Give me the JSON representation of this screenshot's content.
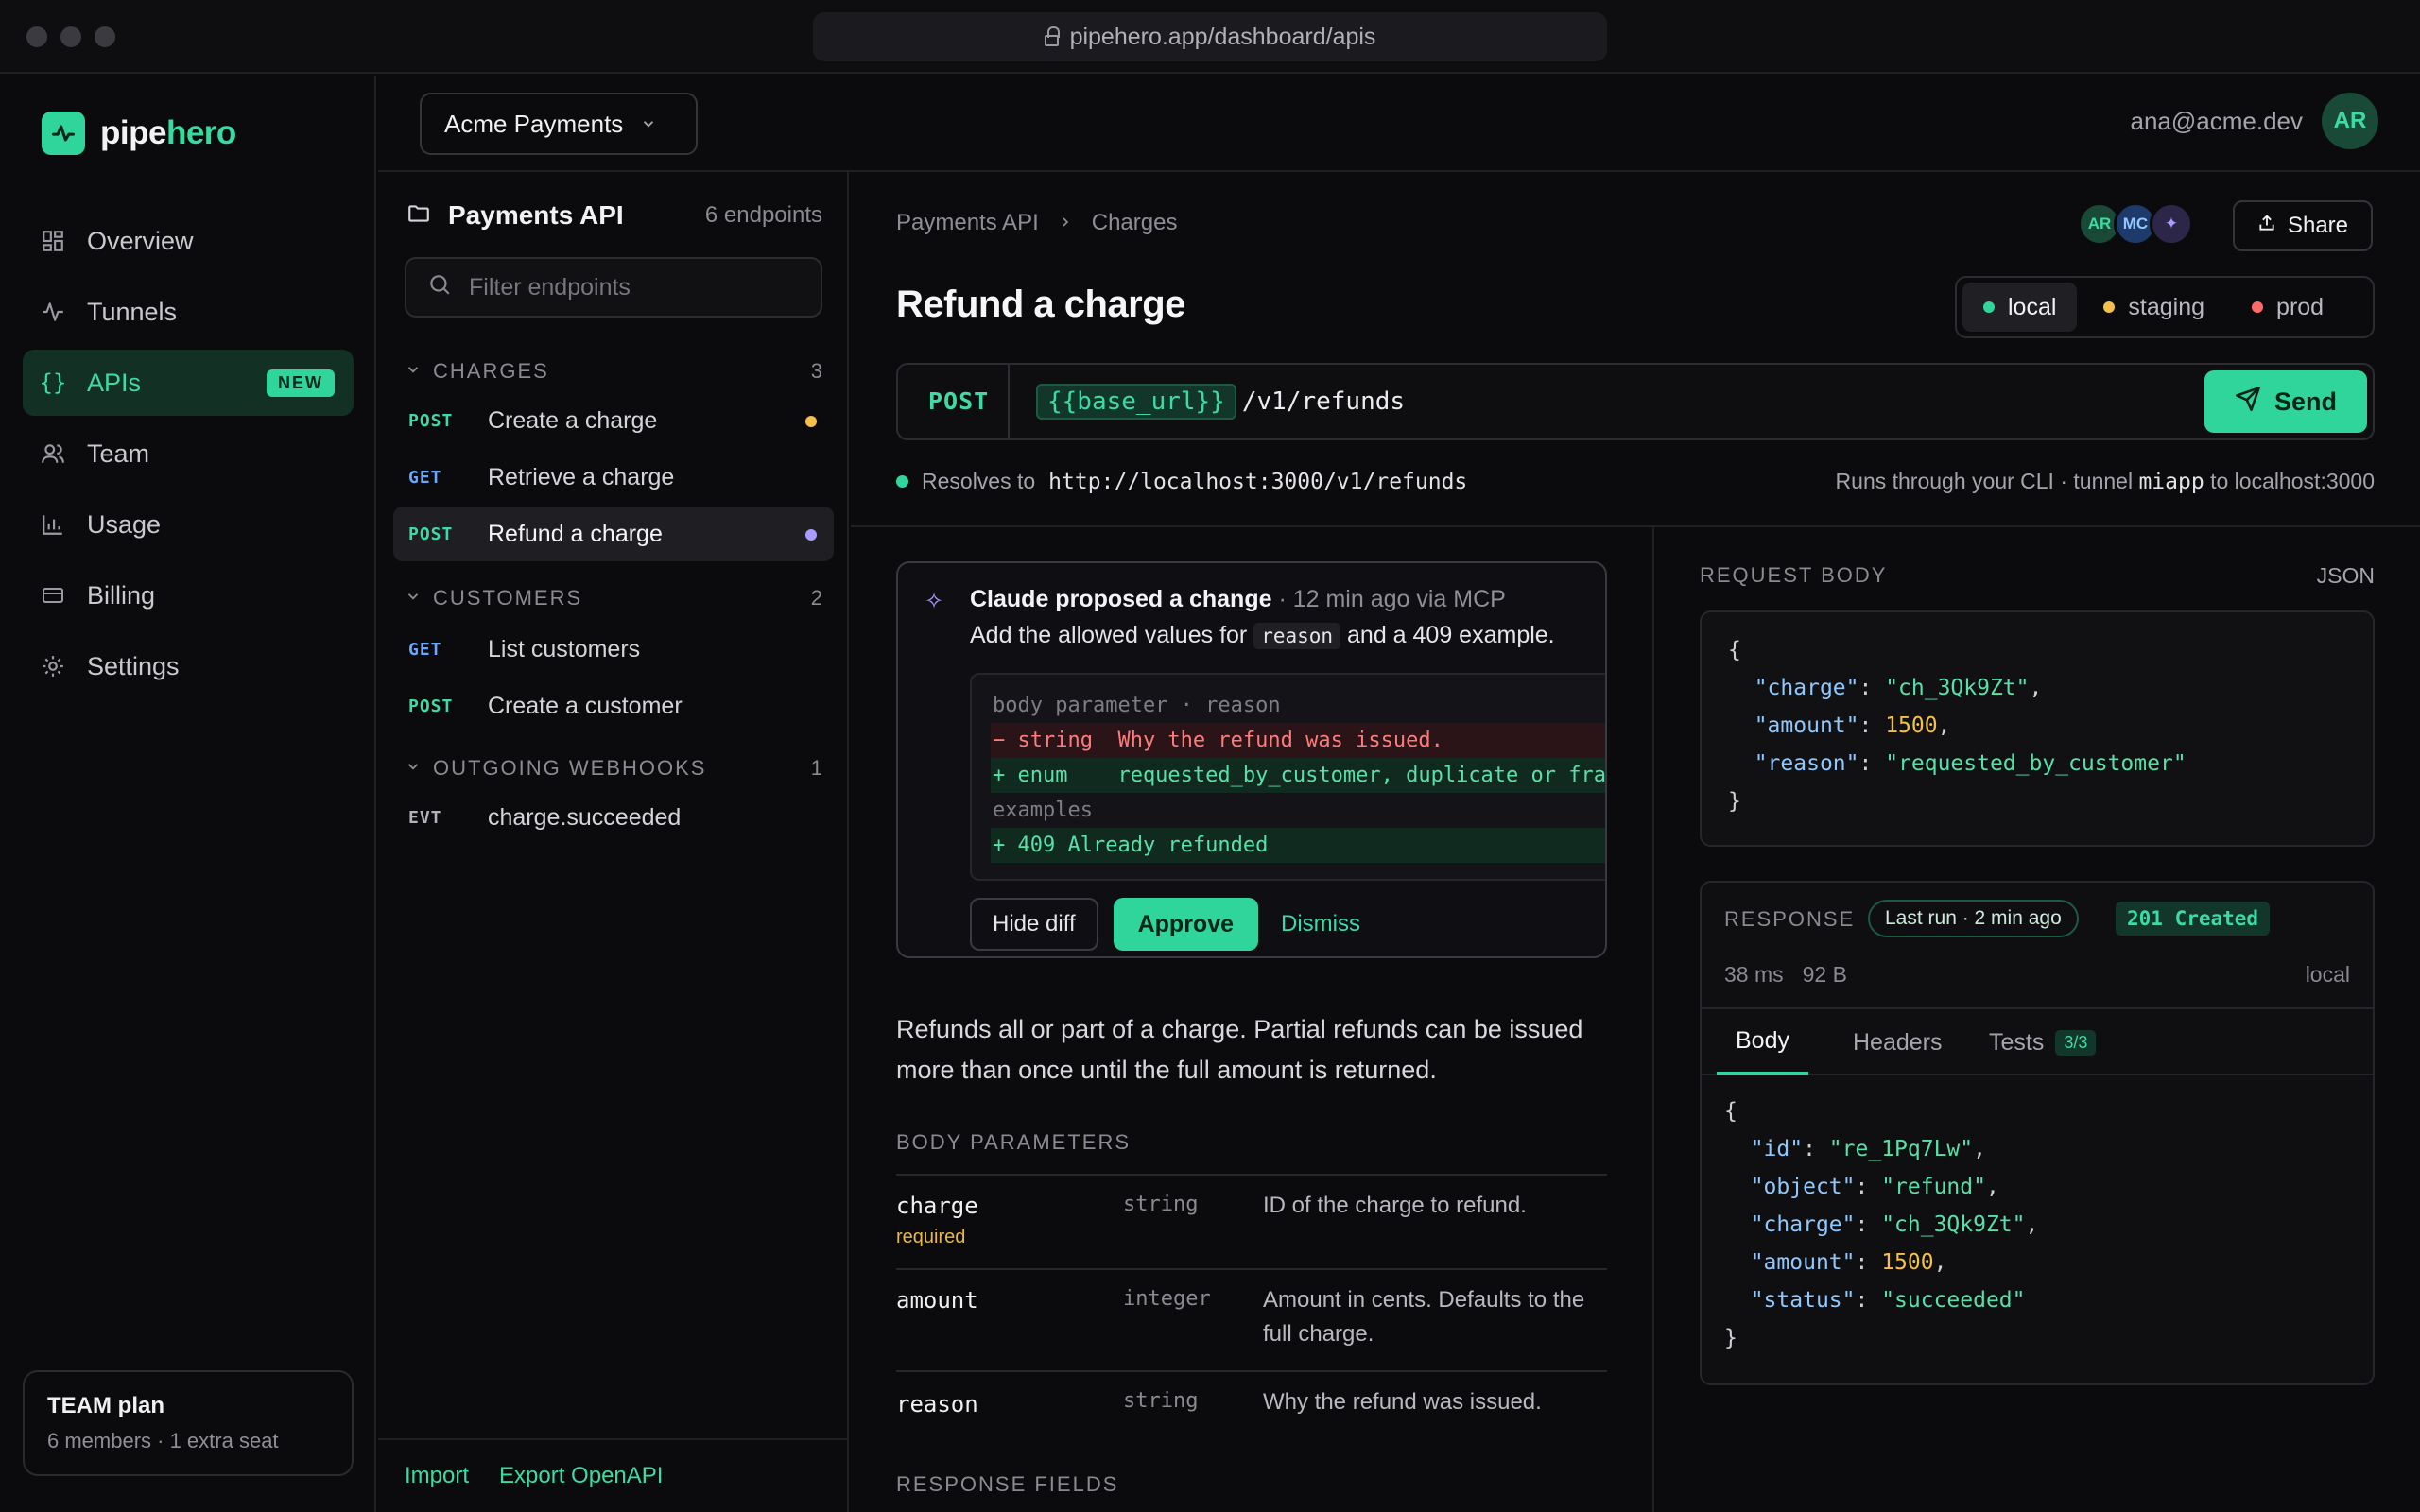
{
  "browser": {
    "url": "pipehero.app/dashboard/apis"
  },
  "brand": {
    "part1": "pipe",
    "part2": "hero"
  },
  "nav": {
    "items": [
      {
        "label": "Overview",
        "icon": "grid-icon"
      },
      {
        "label": "Tunnels",
        "icon": "pulse-icon"
      },
      {
        "label": "APIs",
        "icon": "braces-icon",
        "badge": "NEW",
        "active": true
      },
      {
        "label": "Team",
        "icon": "users-icon"
      },
      {
        "label": "Usage",
        "icon": "bar-chart-icon"
      },
      {
        "label": "Billing",
        "icon": "card-icon"
      },
      {
        "label": "Settings",
        "icon": "gear-icon"
      }
    ]
  },
  "plan": {
    "title": "TEAM plan",
    "subtitle": "6 members · 1 extra seat"
  },
  "workspace": {
    "name": "Acme Payments"
  },
  "user": {
    "email": "ana@acme.dev",
    "initials": "AR"
  },
  "endpoints": {
    "title": "Payments API",
    "count": "6 endpoints",
    "filter_placeholder": "Filter endpoints",
    "groups": [
      {
        "name": "CHARGES",
        "count": "3"
      },
      {
        "name": "CUSTOMERS",
        "count": "2"
      },
      {
        "name": "OUTGOING WEBHOOKS",
        "count": "1"
      }
    ],
    "items": [
      {
        "method": "POST",
        "label": "Create a charge"
      },
      {
        "method": "GET",
        "label": "Retrieve a charge"
      },
      {
        "method": "POST",
        "label": "Refund a charge"
      },
      {
        "method": "GET",
        "label": "List customers"
      },
      {
        "method": "POST",
        "label": "Create a customer"
      },
      {
        "method": "EVT",
        "label": "charge.succeeded"
      }
    ],
    "footer": {
      "import": "Import",
      "export": "Export OpenAPI"
    }
  },
  "breadcrumb": {
    "parent": "Payments API",
    "current": "Charges"
  },
  "collaborators": [
    "AR",
    "MC"
  ],
  "share_label": "Share",
  "title": "Refund a charge",
  "environments": [
    {
      "label": "local",
      "color": "#2fd59b"
    },
    {
      "label": "staging",
      "color": "#f2c04b"
    },
    {
      "label": "prod",
      "color": "#ff6b6b"
    }
  ],
  "request": {
    "method": "POST",
    "base_var": "{{base_url}}",
    "path": "/v1/refunds",
    "send_label": "Send",
    "resolves_prefix": "Resolves to",
    "resolves_url": "http://localhost:3000/v1/refunds",
    "runs_prefix": "Runs through your CLI · tunnel",
    "tunnel": "miapp",
    "runs_suffix": "to localhost:3000"
  },
  "proposal": {
    "author": "Claude proposed a change",
    "meta": " · 12 min ago via MCP",
    "text_before": "Add the allowed values for",
    "code": "reason",
    "text_after": "and a 409 example.",
    "diff": [
      {
        "kind": "meta",
        "text": "body parameter · reason"
      },
      {
        "kind": "del",
        "text": "− string  Why the refund was issued."
      },
      {
        "kind": "add",
        "text": "+ enum    requested_by_customer, duplicate or fraudulent"
      },
      {
        "kind": "meta",
        "text": "examples"
      },
      {
        "kind": "add",
        "text": "+ 409 Already refunded"
      }
    ],
    "hide_diff": "Hide diff",
    "approve": "Approve",
    "dismiss": "Dismiss"
  },
  "description": "Refunds all or part of a charge. Partial refunds can be issued more than once until the full amount is returned.",
  "body_params_label": "BODY PARAMETERS",
  "params": [
    {
      "name": "charge",
      "required": "required",
      "type": "string",
      "desc": "ID of the charge to refund."
    },
    {
      "name": "amount",
      "type": "integer",
      "desc": "Amount in cents. Defaults to the full charge."
    },
    {
      "name": "reason",
      "type": "string",
      "desc": "Why the refund was issued."
    }
  ],
  "response_fields_label": "RESPONSE FIELDS",
  "request_body": {
    "label": "REQUEST BODY",
    "format": "JSON",
    "lines": [
      {
        "kind": "brace",
        "text": "{"
      },
      {
        "kind": "kv",
        "key": "\"charge\"",
        "value": "\"ch_3Qk9Zt\"",
        "vtype": "s",
        "comma": ","
      },
      {
        "kind": "kv",
        "key": "\"amount\"",
        "value": "1500",
        "vtype": "n",
        "comma": ","
      },
      {
        "kind": "kv",
        "key": "\"reason\"",
        "value": "\"requested_by_customer\"",
        "vtype": "s",
        "comma": ""
      },
      {
        "kind": "brace",
        "text": "}"
      }
    ]
  },
  "response": {
    "label": "RESPONSE",
    "last_run": "Last run · 2 min ago",
    "status": "201 Created",
    "time": "38 ms",
    "size": "92 B",
    "env": "local",
    "tabs": [
      {
        "label": "Body"
      },
      {
        "label": "Headers"
      },
      {
        "label": "Tests",
        "badge": "3/3"
      }
    ],
    "lines": [
      {
        "kind": "brace",
        "text": "{"
      },
      {
        "kind": "kv",
        "key": "\"id\"",
        "value": "\"re_1Pq7Lw\"",
        "vtype": "s",
        "comma": ","
      },
      {
        "kind": "kv",
        "key": "\"object\"",
        "value": "\"refund\"",
        "vtype": "s",
        "comma": ","
      },
      {
        "kind": "kv",
        "key": "\"charge\"",
        "value": "\"ch_3Qk9Zt\"",
        "vtype": "s",
        "comma": ","
      },
      {
        "kind": "kv",
        "key": "\"amount\"",
        "value": "1500",
        "vtype": "n",
        "comma": ","
      },
      {
        "kind": "kv",
        "key": "\"status\"",
        "value": "\"succeeded\"",
        "vtype": "s",
        "comma": ""
      },
      {
        "kind": "brace",
        "text": "}"
      }
    ]
  }
}
